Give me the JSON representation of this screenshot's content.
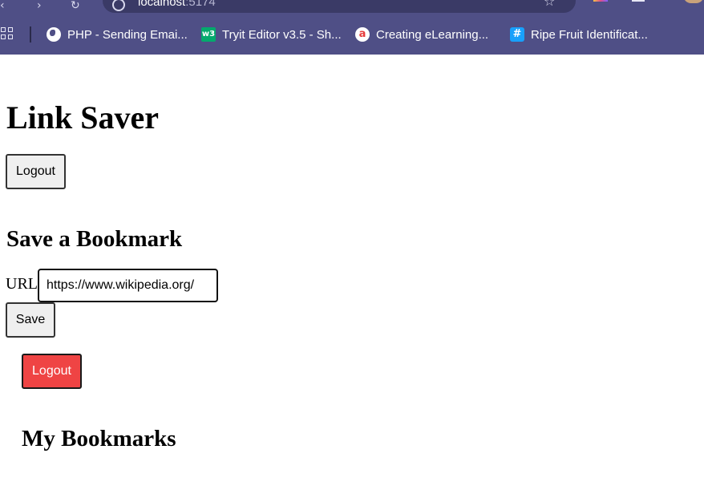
{
  "browser": {
    "address": {
      "host": "localhost",
      "port": ":5174"
    },
    "bookmarks_bar": [
      {
        "label": "PHP - Sending Emai...",
        "icon": "globe-icon"
      },
      {
        "label": "Tryit Editor v3.5 - Sh...",
        "icon": "w3schools-icon"
      },
      {
        "label": "Creating eLearning...",
        "icon": "articulate-icon"
      },
      {
        "label": "Ripe Fruit Identificat...",
        "icon": "hash-icon"
      }
    ]
  },
  "app": {
    "title": "Link Saver",
    "header_logout_label": "Logout",
    "save_section": {
      "heading": "Save a Bookmark",
      "url_label": "URL",
      "url_value": "https://www.wikipedia.org/",
      "save_label": "Save"
    },
    "secondary_logout_label": "Logout",
    "bookmarks_section": {
      "heading": "My Bookmarks"
    }
  },
  "colors": {
    "browser_chrome": "#4f4f86",
    "logout_red": "#ef4444",
    "button_gray": "#efefef"
  }
}
